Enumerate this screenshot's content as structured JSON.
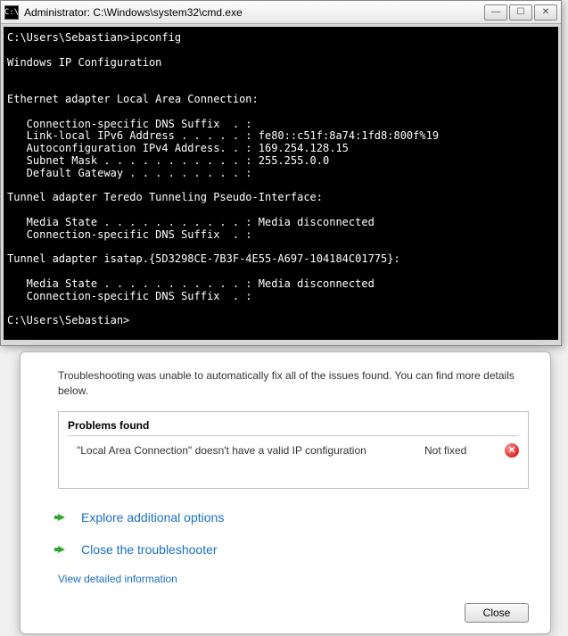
{
  "cmd": {
    "title": "Administrator: C:\\Windows\\system32\\cmd.exe",
    "icon_label": "C:\\",
    "body": "C:\\Users\\Sebastian>ipconfig\n\nWindows IP Configuration\n\n\nEthernet adapter Local Area Connection:\n\n   Connection-specific DNS Suffix  . :\n   Link-local IPv6 Address . . . . . : fe80::c51f:8a74:1fd8:800f%19\n   Autoconfiguration IPv4 Address. . : 169.254.128.15\n   Subnet Mask . . . . . . . . . . . : 255.255.0.0\n   Default Gateway . . . . . . . . . :\n\nTunnel adapter Teredo Tunneling Pseudo-Interface:\n\n   Media State . . . . . . . . . . . : Media disconnected\n   Connection-specific DNS Suffix  . :\n\nTunnel adapter isatap.{5D3298CE-7B3F-4E55-A697-104184C01775}:\n\n   Media State . . . . . . . . . . . : Media disconnected\n   Connection-specific DNS Suffix  . :\n\nC:\\Users\\Sebastian>"
  },
  "troubleshooter": {
    "description": "Troubleshooting was unable to automatically fix all of the issues found. You can find more details below.",
    "problems_header": "Problems found",
    "problem_text": "\"Local Area Connection\" doesn't have a valid IP configuration",
    "problem_status": "Not fixed",
    "explore_label": "Explore additional options",
    "close_ts_label": "Close the troubleshooter",
    "view_detailed": "View detailed information",
    "close_button": "Close"
  }
}
